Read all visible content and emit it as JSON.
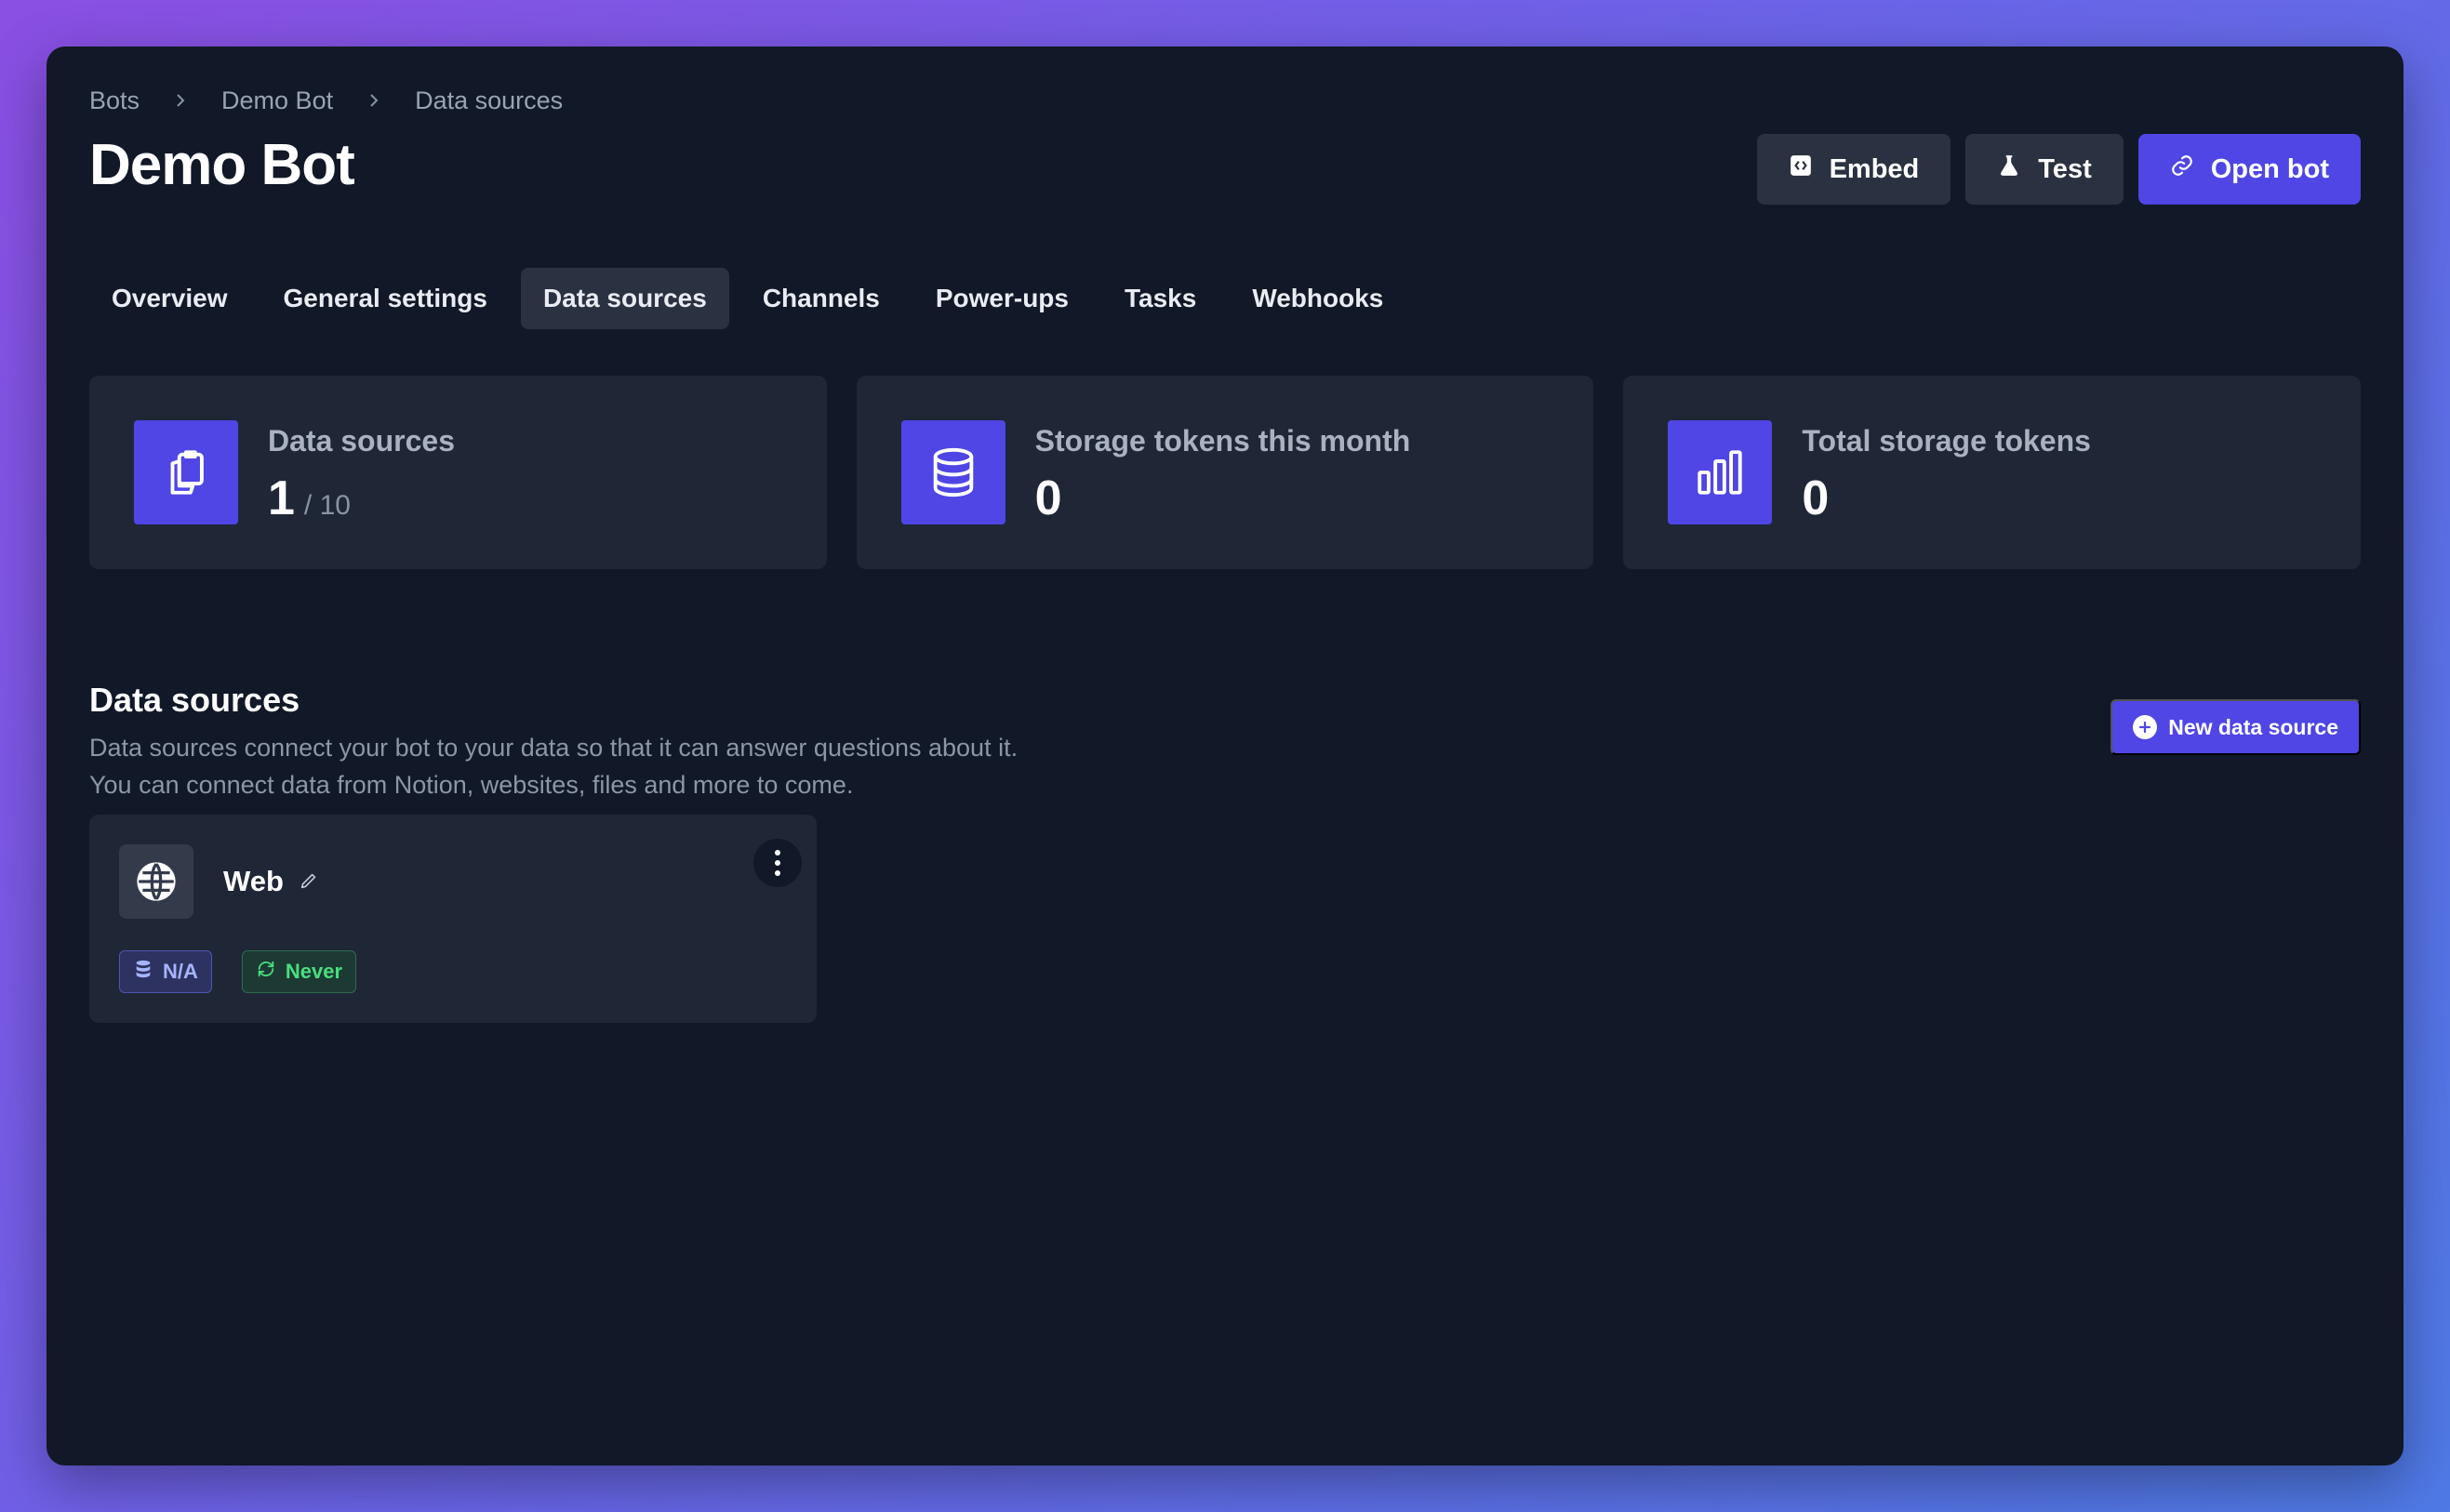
{
  "breadcrumb": {
    "items": [
      "Bots",
      "Demo Bot",
      "Data sources"
    ]
  },
  "page_title": "Demo Bot",
  "header_actions": {
    "embed": "Embed",
    "test": "Test",
    "open_bot": "Open bot"
  },
  "tabs": [
    {
      "label": "Overview"
    },
    {
      "label": "General settings"
    },
    {
      "label": "Data sources",
      "active": true
    },
    {
      "label": "Channels"
    },
    {
      "label": "Power-ups"
    },
    {
      "label": "Tasks"
    },
    {
      "label": "Webhooks"
    }
  ],
  "stats": [
    {
      "label": "Data sources",
      "value": "1",
      "sub": "/ 10",
      "icon": "clipboard-icon"
    },
    {
      "label": "Storage tokens this month",
      "value": "0",
      "icon": "database-icon"
    },
    {
      "label": "Total storage tokens",
      "value": "0",
      "icon": "bar-chart-icon"
    }
  ],
  "section": {
    "title": "Data sources",
    "description": "Data sources connect your bot to your data so that it can answer questions about it. You can connect data from Notion, websites, files and more to come.",
    "new_button": "New data source"
  },
  "data_sources": [
    {
      "name": "Web",
      "icon": "globe-icon",
      "storage_badge": "N/A",
      "sync_badge": "Never"
    }
  ],
  "colors": {
    "accent": "#4f46e5",
    "background": "#111827",
    "card": "#1f2737",
    "success": "#4ade80"
  }
}
